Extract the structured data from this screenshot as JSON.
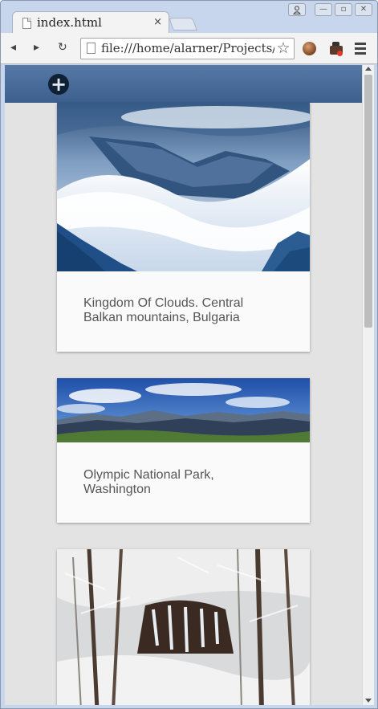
{
  "browser": {
    "tab_title": "index.html",
    "tab_close": "×",
    "address_url": "file:///home/alarner/Projects/",
    "star": "☆",
    "nav_back": "◂",
    "nav_forward": "▸",
    "nav_reload": "↻",
    "window_minimize": "—",
    "window_maximize": "▫",
    "window_close": "✕",
    "profile_icon": "person-icon"
  },
  "app": {
    "header_color": "#4a6d9b",
    "add_button_label": "+"
  },
  "cards": [
    {
      "caption": "Kingdom Of Clouds. Central Balkan mountains, Bulgaria",
      "image": "misty-snowy-mountain-valley"
    },
    {
      "caption": "Olympic National Park, Washington",
      "image": "mountain-panorama-blue-sky"
    },
    {
      "caption": "",
      "image": "snowy-forest-frozen-waterfall"
    }
  ]
}
